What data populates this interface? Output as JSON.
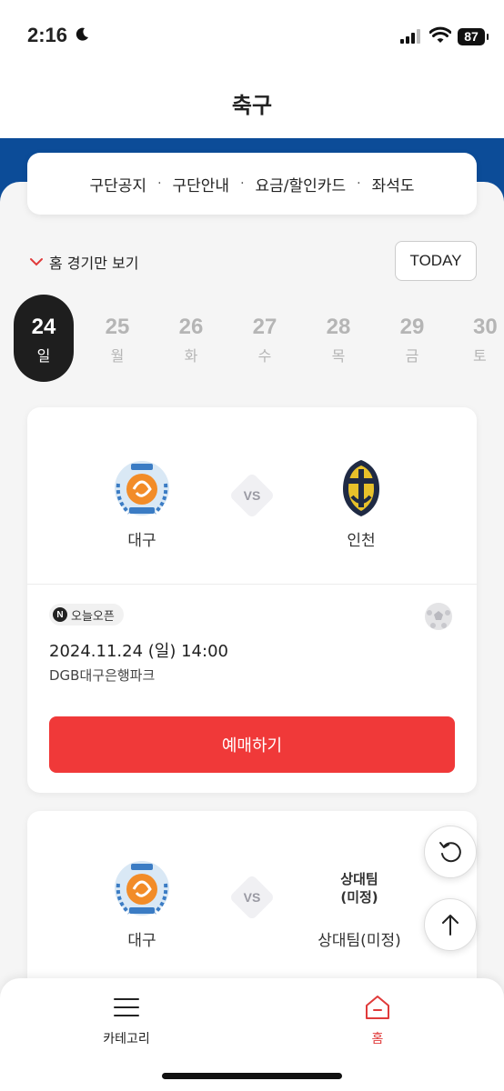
{
  "status_bar": {
    "time": "2:16",
    "battery": "87"
  },
  "header": {
    "title": "축구"
  },
  "club_links": [
    "구단공지",
    "구단안내",
    "요금/할인카드",
    "좌석도"
  ],
  "filter": {
    "home_only_label": "홈 경기만 보기",
    "today_label": "TODAY"
  },
  "dates": [
    {
      "day": "24",
      "dow": "일",
      "selected": true
    },
    {
      "day": "25",
      "dow": "월"
    },
    {
      "day": "26",
      "dow": "화"
    },
    {
      "day": "27",
      "dow": "수"
    },
    {
      "day": "28",
      "dow": "목"
    },
    {
      "day": "29",
      "dow": "금"
    },
    {
      "day": "30",
      "dow": "토"
    }
  ],
  "matches": [
    {
      "home_team": "대구",
      "away_team": "인천",
      "vs": "VS",
      "badge": "오늘오픈",
      "badge_icon": "N",
      "datetime": "2024.11.24 (일) 14:00",
      "venue": "DGB대구은행파크",
      "book_label": "예매하기"
    },
    {
      "home_team": "대구",
      "away_team": "상대팀(미정)",
      "away_logo_text_1": "상대팀",
      "away_logo_text_2": "(미정)",
      "vs": "VS"
    }
  ],
  "bottom_nav": {
    "category_label": "카테고리",
    "home_label": "홈"
  },
  "colors": {
    "brand_blue": "#0c4c98",
    "book_red": "#f03939",
    "active_red": "#e03a3a"
  }
}
